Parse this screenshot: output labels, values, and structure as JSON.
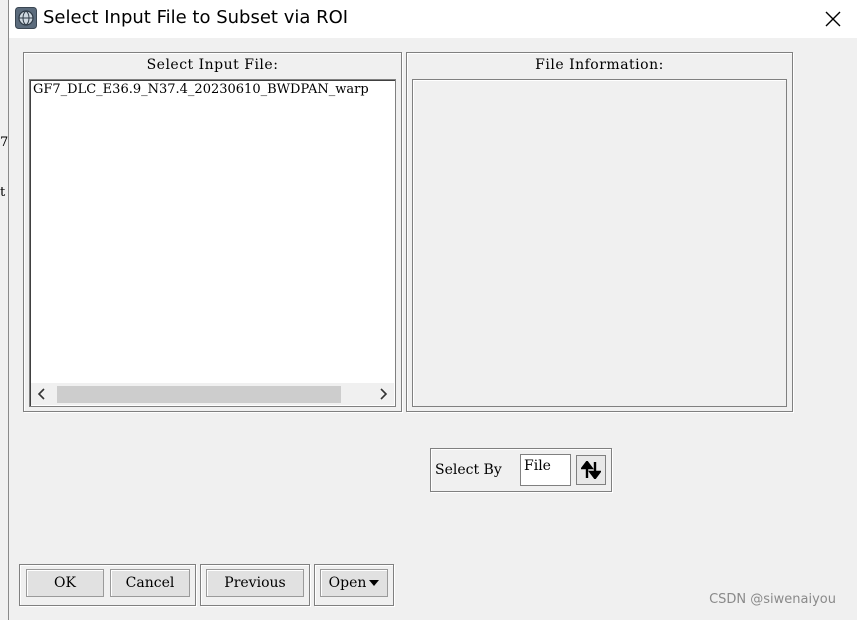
{
  "background_fragments": [
    "7.",
    "t"
  ],
  "window": {
    "title": "Select Input File to Subset via ROI"
  },
  "input_panel": {
    "title": "Select Input File:",
    "files": [
      "GF7_DLC_E36.9_N37.4_20230610_BWDPAN_warp"
    ]
  },
  "info_panel": {
    "title": "File Information:"
  },
  "select_by": {
    "label": "Select By",
    "value": "File"
  },
  "buttons": {
    "ok": "OK",
    "cancel": "Cancel",
    "previous": "Previous",
    "open": "Open"
  },
  "watermark": "CSDN @siwenaiyou"
}
